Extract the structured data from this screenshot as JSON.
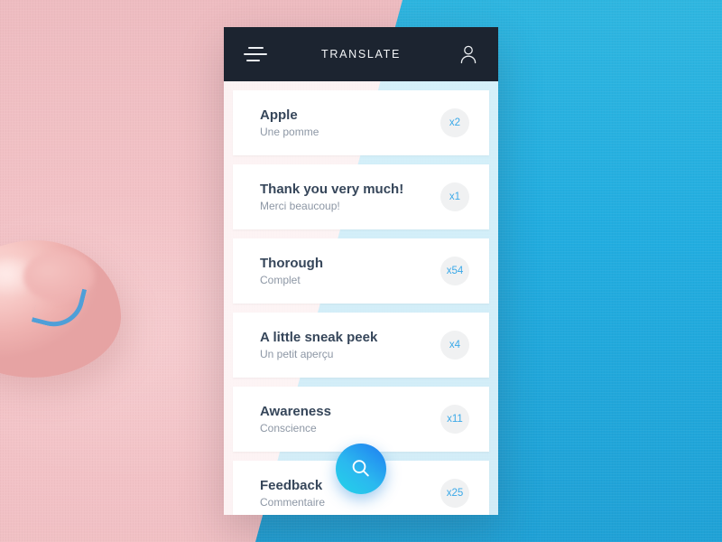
{
  "app": {
    "title": "TRANSLATE",
    "menu_icon": "hamburger-menu-icon",
    "account_icon": "user-account-icon"
  },
  "theme": {
    "header_bg": "#1c2430",
    "card_bg": "#ffffff",
    "title_color": "#36465a",
    "subtitle_color": "#8d97a5",
    "badge_bg": "#f0f1f2",
    "badge_text": "#3ba9e8",
    "accent_gradient_from": "#23d3e8",
    "accent_gradient_to": "#1f7cf0",
    "background_pink": "#f2c2c6",
    "background_blue": "#22ade0"
  },
  "list": {
    "items": [
      {
        "title": "Apple",
        "subtitle": "Une pomme",
        "count": "x2"
      },
      {
        "title": "Thank you very much!",
        "subtitle": "Merci beaucoup!",
        "count": "x1"
      },
      {
        "title": "Thorough",
        "subtitle": "Complet",
        "count": "x54"
      },
      {
        "title": "A little sneak peek",
        "subtitle": "Un petit aperçu",
        "count": "x4"
      },
      {
        "title": "Awareness",
        "subtitle": "Conscience",
        "count": "x11"
      },
      {
        "title": "Feedback",
        "subtitle": "Commentaire",
        "count": "x25"
      }
    ]
  },
  "fab": {
    "icon": "search-icon",
    "label": "Search"
  }
}
